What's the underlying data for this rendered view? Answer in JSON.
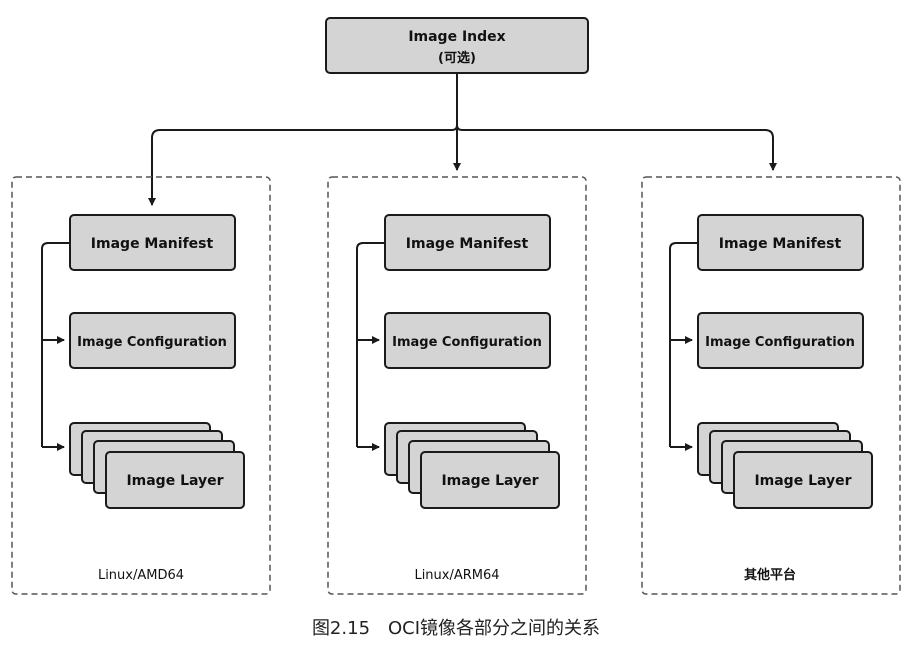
{
  "index": {
    "title": "Image Index",
    "subtitle": "(可选)"
  },
  "groups": [
    {
      "manifest": "Image Manifest",
      "config": "Image Configuration",
      "layer": "Image Layer",
      "platform": "Linux/AMD64"
    },
    {
      "manifest": "Image Manifest",
      "config": "Image Configuration",
      "layer": "Image Layer",
      "platform": "Linux/ARM64"
    },
    {
      "manifest": "Image Manifest",
      "config": "Image Configuration",
      "layer": "Image Layer",
      "platform": "其他平台"
    }
  ],
  "caption": "图2.15　OCI镜像各部分之间的关系",
  "colors": {
    "box_fill": "#d4d4d4",
    "box_stroke": "#1a1a1a",
    "dashed_border": "#555555",
    "line": "#1a1a1a"
  }
}
